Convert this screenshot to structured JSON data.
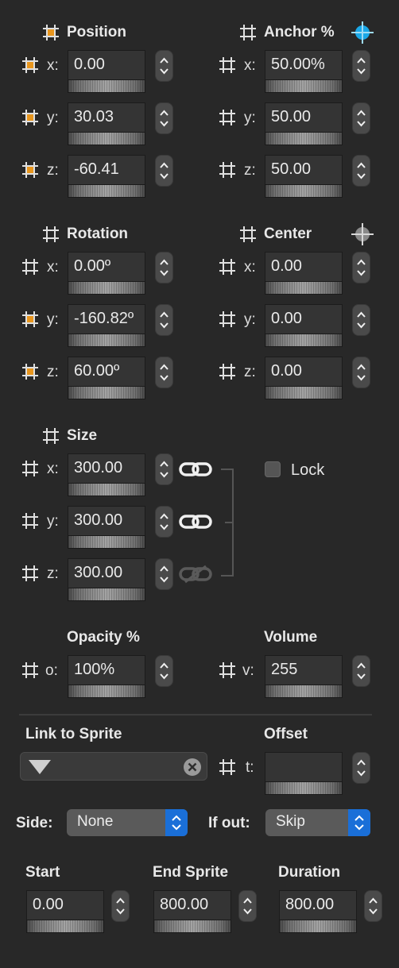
{
  "position": {
    "title": "Position",
    "x": {
      "label": "x:",
      "value": "0.00"
    },
    "y": {
      "label": "y:",
      "value": "30.03"
    },
    "z": {
      "label": "z:",
      "value": "-60.41"
    }
  },
  "anchor": {
    "title": "Anchor %",
    "x": {
      "label": "x:",
      "value": "50.00%"
    },
    "y": {
      "label": "y:",
      "value": "50.00"
    },
    "z": {
      "label": "z:",
      "value": "50.00"
    }
  },
  "rotation": {
    "title": "Rotation",
    "x": {
      "label": "x:",
      "value": "0.00º"
    },
    "y": {
      "label": "y:",
      "value": "-160.82º"
    },
    "z": {
      "label": "z:",
      "value": "60.00º"
    }
  },
  "center": {
    "title": "Center",
    "x": {
      "label": "x:",
      "value": "0.00"
    },
    "y": {
      "label": "y:",
      "value": "0.00"
    },
    "z": {
      "label": "z:",
      "value": "0.00"
    }
  },
  "size": {
    "title": "Size",
    "x": {
      "label": "x:",
      "value": "300.00"
    },
    "y": {
      "label": "y:",
      "value": "300.00"
    },
    "z": {
      "label": "z:",
      "value": "300.00"
    },
    "lock_label": "Lock",
    "lock_checked": false
  },
  "opacity": {
    "title": "Opacity %",
    "label": "o:",
    "value": "100%"
  },
  "volume": {
    "title": "Volume",
    "label": "v:",
    "value": "255"
  },
  "link_to_sprite": {
    "title": "Link to Sprite",
    "value": ""
  },
  "offset": {
    "title": "Offset",
    "label": "t:",
    "value": ""
  },
  "side": {
    "label": "Side:",
    "value": "None"
  },
  "if_out": {
    "label": "If out:",
    "value": "Skip"
  },
  "start": {
    "title": "Start",
    "value": "0.00"
  },
  "end_sprite": {
    "title": "End Sprite",
    "value": "800.00"
  },
  "duration": {
    "title": "Duration",
    "value": "800.00"
  },
  "colors": {
    "background": "#282828",
    "keyframe_orange": "#e8961e",
    "accent_blue": "#1a6fd8",
    "anchor_target": "#1aa8e8"
  },
  "icons": [
    "keyframe-grid-icon",
    "anchor-target-icon",
    "center-target-icon",
    "chain-link-icon",
    "broken-link-icon",
    "stepper-arrows-icon",
    "clear-x-icon",
    "dropdown-triangle-icon"
  ]
}
